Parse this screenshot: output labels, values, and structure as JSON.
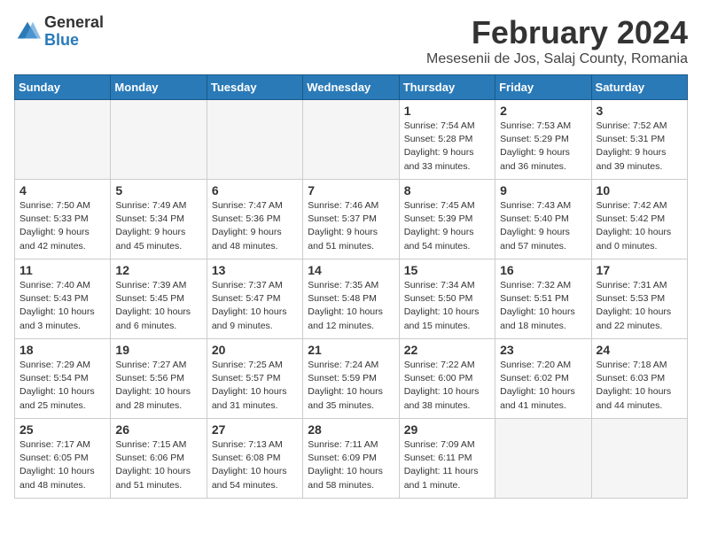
{
  "logo": {
    "general": "General",
    "blue": "Blue"
  },
  "title": "February 2024",
  "subtitle": "Mesesenii de Jos, Salaj County, Romania",
  "days_header": [
    "Sunday",
    "Monday",
    "Tuesday",
    "Wednesday",
    "Thursday",
    "Friday",
    "Saturday"
  ],
  "weeks": [
    [
      {
        "day": "",
        "info": ""
      },
      {
        "day": "",
        "info": ""
      },
      {
        "day": "",
        "info": ""
      },
      {
        "day": "",
        "info": ""
      },
      {
        "day": "1",
        "info": "Sunrise: 7:54 AM\nSunset: 5:28 PM\nDaylight: 9 hours\nand 33 minutes."
      },
      {
        "day": "2",
        "info": "Sunrise: 7:53 AM\nSunset: 5:29 PM\nDaylight: 9 hours\nand 36 minutes."
      },
      {
        "day": "3",
        "info": "Sunrise: 7:52 AM\nSunset: 5:31 PM\nDaylight: 9 hours\nand 39 minutes."
      }
    ],
    [
      {
        "day": "4",
        "info": "Sunrise: 7:50 AM\nSunset: 5:33 PM\nDaylight: 9 hours\nand 42 minutes."
      },
      {
        "day": "5",
        "info": "Sunrise: 7:49 AM\nSunset: 5:34 PM\nDaylight: 9 hours\nand 45 minutes."
      },
      {
        "day": "6",
        "info": "Sunrise: 7:47 AM\nSunset: 5:36 PM\nDaylight: 9 hours\nand 48 minutes."
      },
      {
        "day": "7",
        "info": "Sunrise: 7:46 AM\nSunset: 5:37 PM\nDaylight: 9 hours\nand 51 minutes."
      },
      {
        "day": "8",
        "info": "Sunrise: 7:45 AM\nSunset: 5:39 PM\nDaylight: 9 hours\nand 54 minutes."
      },
      {
        "day": "9",
        "info": "Sunrise: 7:43 AM\nSunset: 5:40 PM\nDaylight: 9 hours\nand 57 minutes."
      },
      {
        "day": "10",
        "info": "Sunrise: 7:42 AM\nSunset: 5:42 PM\nDaylight: 10 hours\nand 0 minutes."
      }
    ],
    [
      {
        "day": "11",
        "info": "Sunrise: 7:40 AM\nSunset: 5:43 PM\nDaylight: 10 hours\nand 3 minutes."
      },
      {
        "day": "12",
        "info": "Sunrise: 7:39 AM\nSunset: 5:45 PM\nDaylight: 10 hours\nand 6 minutes."
      },
      {
        "day": "13",
        "info": "Sunrise: 7:37 AM\nSunset: 5:47 PM\nDaylight: 10 hours\nand 9 minutes."
      },
      {
        "day": "14",
        "info": "Sunrise: 7:35 AM\nSunset: 5:48 PM\nDaylight: 10 hours\nand 12 minutes."
      },
      {
        "day": "15",
        "info": "Sunrise: 7:34 AM\nSunset: 5:50 PM\nDaylight: 10 hours\nand 15 minutes."
      },
      {
        "day": "16",
        "info": "Sunrise: 7:32 AM\nSunset: 5:51 PM\nDaylight: 10 hours\nand 18 minutes."
      },
      {
        "day": "17",
        "info": "Sunrise: 7:31 AM\nSunset: 5:53 PM\nDaylight: 10 hours\nand 22 minutes."
      }
    ],
    [
      {
        "day": "18",
        "info": "Sunrise: 7:29 AM\nSunset: 5:54 PM\nDaylight: 10 hours\nand 25 minutes."
      },
      {
        "day": "19",
        "info": "Sunrise: 7:27 AM\nSunset: 5:56 PM\nDaylight: 10 hours\nand 28 minutes."
      },
      {
        "day": "20",
        "info": "Sunrise: 7:25 AM\nSunset: 5:57 PM\nDaylight: 10 hours\nand 31 minutes."
      },
      {
        "day": "21",
        "info": "Sunrise: 7:24 AM\nSunset: 5:59 PM\nDaylight: 10 hours\nand 35 minutes."
      },
      {
        "day": "22",
        "info": "Sunrise: 7:22 AM\nSunset: 6:00 PM\nDaylight: 10 hours\nand 38 minutes."
      },
      {
        "day": "23",
        "info": "Sunrise: 7:20 AM\nSunset: 6:02 PM\nDaylight: 10 hours\nand 41 minutes."
      },
      {
        "day": "24",
        "info": "Sunrise: 7:18 AM\nSunset: 6:03 PM\nDaylight: 10 hours\nand 44 minutes."
      }
    ],
    [
      {
        "day": "25",
        "info": "Sunrise: 7:17 AM\nSunset: 6:05 PM\nDaylight: 10 hours\nand 48 minutes."
      },
      {
        "day": "26",
        "info": "Sunrise: 7:15 AM\nSunset: 6:06 PM\nDaylight: 10 hours\nand 51 minutes."
      },
      {
        "day": "27",
        "info": "Sunrise: 7:13 AM\nSunset: 6:08 PM\nDaylight: 10 hours\nand 54 minutes."
      },
      {
        "day": "28",
        "info": "Sunrise: 7:11 AM\nSunset: 6:09 PM\nDaylight: 10 hours\nand 58 minutes."
      },
      {
        "day": "29",
        "info": "Sunrise: 7:09 AM\nSunset: 6:11 PM\nDaylight: 11 hours\nand 1 minute."
      },
      {
        "day": "",
        "info": ""
      },
      {
        "day": "",
        "info": ""
      }
    ]
  ]
}
